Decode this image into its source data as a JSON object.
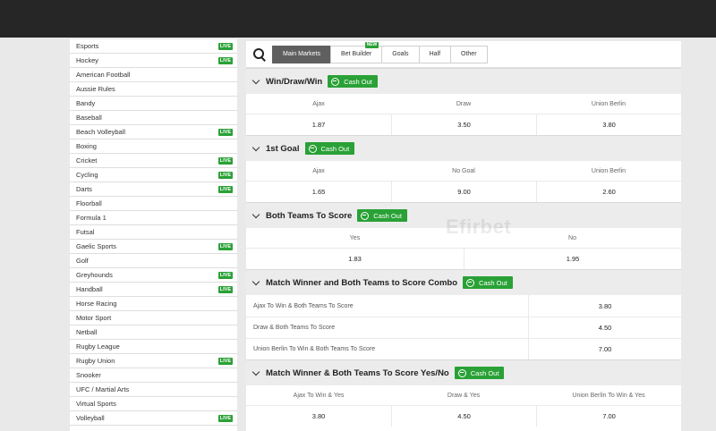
{
  "sidebar": {
    "items": [
      {
        "label": "Esports",
        "live": true
      },
      {
        "label": "Hockey",
        "live": true
      },
      {
        "label": "American Football",
        "live": false
      },
      {
        "label": "Aussie Rules",
        "live": false
      },
      {
        "label": "Bandy",
        "live": false
      },
      {
        "label": "Baseball",
        "live": false
      },
      {
        "label": "Beach Volleyball",
        "live": true
      },
      {
        "label": "Boxing",
        "live": false
      },
      {
        "label": "Cricket",
        "live": true
      },
      {
        "label": "Cycling",
        "live": true
      },
      {
        "label": "Darts",
        "live": true
      },
      {
        "label": "Floorball",
        "live": false
      },
      {
        "label": "Formula 1",
        "live": false
      },
      {
        "label": "Futsal",
        "live": false
      },
      {
        "label": "Gaelic Sports",
        "live": true
      },
      {
        "label": "Golf",
        "live": false
      },
      {
        "label": "Greyhounds",
        "live": true
      },
      {
        "label": "Handball",
        "live": true
      },
      {
        "label": "Horse Racing",
        "live": false
      },
      {
        "label": "Motor Sport",
        "live": false
      },
      {
        "label": "Netball",
        "live": false
      },
      {
        "label": "Rugby League",
        "live": false
      },
      {
        "label": "Rugby Union",
        "live": true
      },
      {
        "label": "Snooker",
        "live": false
      },
      {
        "label": "UFC / Martial Arts",
        "live": false
      },
      {
        "label": "Virtual Sports",
        "live": false
      },
      {
        "label": "Volleyball",
        "live": true
      }
    ],
    "live_label": "LIVE"
  },
  "tabs": {
    "items": [
      {
        "label": "Main Markets",
        "active": true,
        "badge": ""
      },
      {
        "label": "Bet Builder",
        "active": false,
        "badge": "NEW"
      },
      {
        "label": "Goals",
        "active": false,
        "badge": ""
      },
      {
        "label": "Half",
        "active": false,
        "badge": ""
      },
      {
        "label": "Other",
        "active": false,
        "badge": ""
      }
    ]
  },
  "cashout_label": "Cash Out",
  "watermark": "Efirbet",
  "markets": {
    "wdw": {
      "title": "Win/Draw/Win",
      "outcomes": [
        {
          "label": "Ajax",
          "odds": "1.87"
        },
        {
          "label": "Draw",
          "odds": "3.50"
        },
        {
          "label": "Union Berlin",
          "odds": "3.80"
        }
      ]
    },
    "first_goal": {
      "title": "1st Goal",
      "outcomes": [
        {
          "label": "Ajax",
          "odds": "1.65"
        },
        {
          "label": "No Goal",
          "odds": "9.00"
        },
        {
          "label": "Union Berlin",
          "odds": "2.60"
        }
      ]
    },
    "btts": {
      "title": "Both Teams To Score",
      "outcomes": [
        {
          "label": "Yes",
          "odds": "1.83"
        },
        {
          "label": "No",
          "odds": "1.95"
        }
      ]
    },
    "combo": {
      "title": "Match Winner and Both Teams to Score Combo",
      "rows": [
        {
          "label": "Ajax To Win & Both Teams To Score",
          "odds": "3.80"
        },
        {
          "label": "Draw & Both Teams To Score",
          "odds": "4.50"
        },
        {
          "label": "Union Berlin To Win & Both Teams To Score",
          "odds": "7.00"
        }
      ]
    },
    "mw_btts_yn": {
      "title": "Match Winner & Both Teams To Score Yes/No",
      "outcomes": [
        {
          "label": "Ajax To Win & Yes",
          "odds": "3.80"
        },
        {
          "label": "Draw & Yes",
          "odds": "4.50"
        },
        {
          "label": "Union Berlin To Win & Yes",
          "odds": "7.00"
        }
      ]
    }
  }
}
